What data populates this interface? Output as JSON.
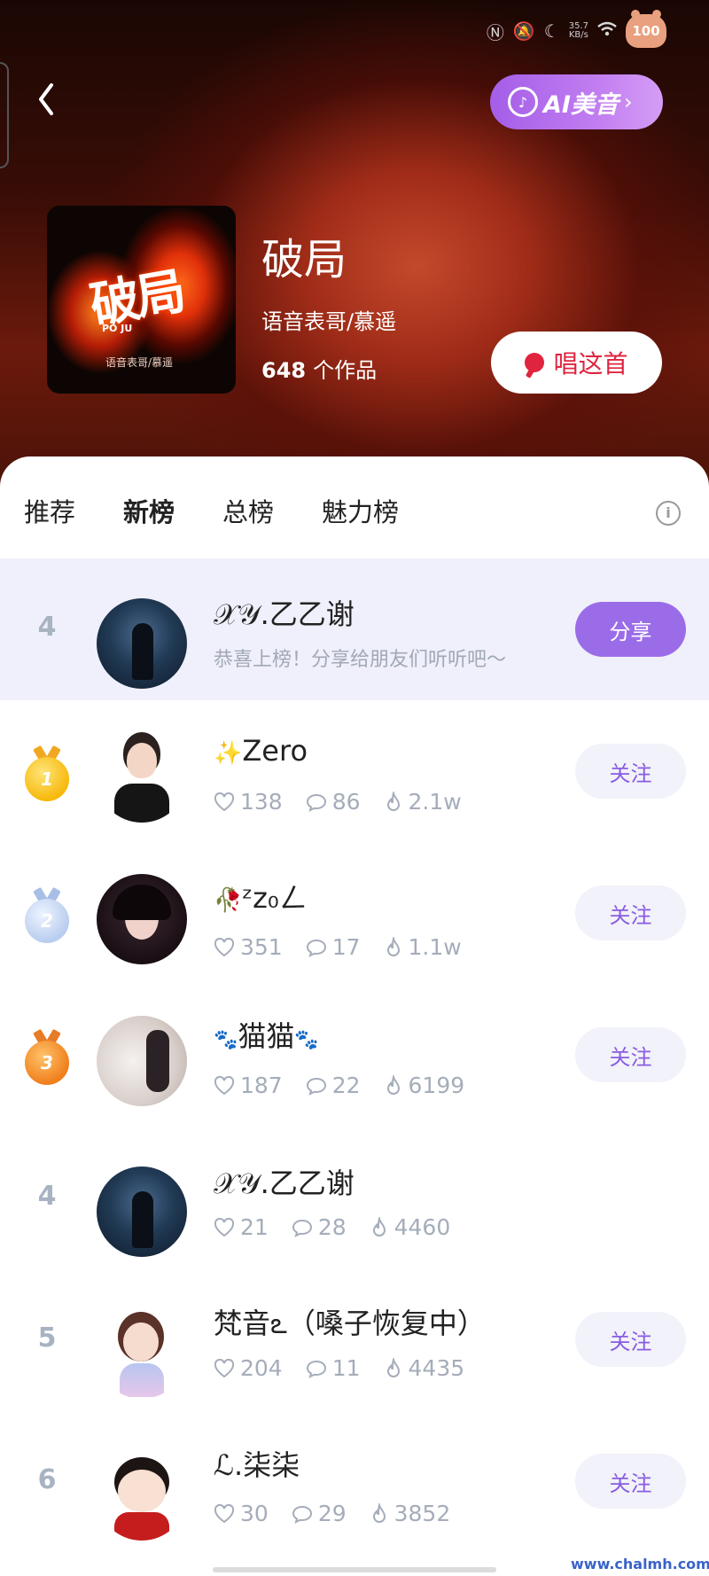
{
  "status": {
    "speed": "35.7\nKB/s",
    "battery": "100"
  },
  "header": {
    "ai_button": {
      "icon": "music-note-ai-icon",
      "label": "AI美音",
      "chevron": "›"
    },
    "cover": {
      "title": "破局",
      "subtitle": "PO JU",
      "artist": "语音表哥/慕遥"
    },
    "song_title": "破局",
    "artist": "语音表哥/慕遥",
    "works_count": "648",
    "works_suffix": "个作品",
    "sing_button": "唱这首"
  },
  "tabs": [
    {
      "label": "推荐",
      "active": false
    },
    {
      "label": "新榜",
      "active": true
    },
    {
      "label": "总榜",
      "active": false
    },
    {
      "label": "魅力榜",
      "active": false
    }
  ],
  "info_icon": "i",
  "my_entry": {
    "rank": "4",
    "name": "𝒳𝒴.乙乙谢",
    "message": "恭喜上榜！分享给朋友们听听吧～",
    "share_label": "分享"
  },
  "list": [
    {
      "rank": "1",
      "medal": "gold",
      "emoji": "✨",
      "name": "Zero",
      "likes": "138",
      "comments": "86",
      "heat": "2.1w",
      "follow_label": "关注"
    },
    {
      "rank": "2",
      "medal": "silver",
      "emoji": "🥀",
      "name": "ᶻz₀ㄥ",
      "likes": "351",
      "comments": "17",
      "heat": "1.1w",
      "follow_label": "关注"
    },
    {
      "rank": "3",
      "medal": "bronze",
      "emoji": "🐾",
      "name": "猫猫",
      "emoji_after": "🐾",
      "likes": "187",
      "comments": "22",
      "heat": "6199",
      "follow_label": "关注"
    },
    {
      "rank": "4",
      "name": "𝒳𝒴.乙乙谢",
      "likes": "21",
      "comments": "28",
      "heat": "4460"
    },
    {
      "rank": "5",
      "name": "梵音ఽ（嗓子恢复中）",
      "likes": "204",
      "comments": "11",
      "heat": "4435",
      "follow_label": "关注"
    },
    {
      "rank": "6",
      "name": "ℒ.柒柒",
      "likes": "30",
      "comments": "29",
      "heat": "3852",
      "follow_label": "关注"
    }
  ],
  "watermark": "www.chalmh.com"
}
